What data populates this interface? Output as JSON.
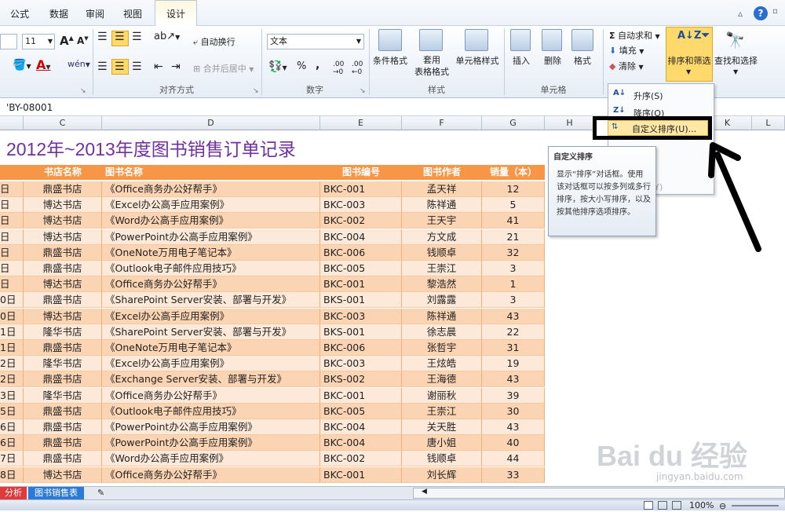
{
  "ribbon_tabs": [
    "公式",
    "数据",
    "审阅",
    "视图",
    "设计"
  ],
  "font": {
    "size": "11",
    "grow_glyph": "A",
    "shrink_glyph": "A"
  },
  "alignment": {
    "group_label": "对齐方式",
    "wrap_label": "自动换行",
    "merge_label": "合并后居中"
  },
  "number": {
    "group_label": "数字",
    "format_value": "文本",
    "percent": "%",
    "comma": ","
  },
  "styles": {
    "group_label": "样式",
    "conditional": "条件格式",
    "table_format": "套用\n表格格式",
    "cell_styles": "单元格样式"
  },
  "cells": {
    "group_label": "单元格",
    "insert": "插入",
    "delete": "删除",
    "format": "格式"
  },
  "editing": {
    "autosum": "自动求和",
    "fill": "填充",
    "clear": "清除",
    "sort_filter": "排序和筛选",
    "find_select": "查找和选择",
    "sigma": "Σ"
  },
  "formula_bar": "'BY-08001",
  "columns": [
    "C",
    "D",
    "E",
    "F",
    "G",
    "H",
    "I",
    "K",
    "L"
  ],
  "sheet_title": "2012年~2013年度图书销售订单记录",
  "table_headers": [
    "书店名称",
    "图书名称",
    "图书编号",
    "图书作者",
    "销量（本）"
  ],
  "rows": [
    {
      "d": "日",
      "store": "鼎盛书店",
      "book": "《Office商务办公好帮手》",
      "id": "BKC-001",
      "author": "孟天祥",
      "qty": "12"
    },
    {
      "d": "日",
      "store": "博达书店",
      "book": "《Excel办公高手应用案例》",
      "id": "BKC-003",
      "author": "陈祥通",
      "qty": "5"
    },
    {
      "d": "日",
      "store": "博达书店",
      "book": "《Word办公高手应用案例》",
      "id": "BKC-002",
      "author": "王天宇",
      "qty": "41"
    },
    {
      "d": "日",
      "store": "博达书店",
      "book": "《PowerPoint办公高手应用案例》",
      "id": "BKC-004",
      "author": "方文成",
      "qty": "21"
    },
    {
      "d": "日",
      "store": "鼎盛书店",
      "book": "《OneNote万用电子笔记本》",
      "id": "BKC-006",
      "author": "钱顺卓",
      "qty": "32"
    },
    {
      "d": "日",
      "store": "鼎盛书店",
      "book": "《Outlook电子邮件应用技巧》",
      "id": "BKC-005",
      "author": "王崇江",
      "qty": "3"
    },
    {
      "d": "日",
      "store": "博达书店",
      "book": "《Office商务办公好帮手》",
      "id": "BKC-001",
      "author": "黎浩然",
      "qty": "1"
    },
    {
      "d": "0日",
      "store": "鼎盛书店",
      "book": "《SharePoint Server安装、部署与开发》",
      "id": "BKS-001",
      "author": "刘露露",
      "qty": "3"
    },
    {
      "d": "0日",
      "store": "博达书店",
      "book": "《Excel办公高手应用案例》",
      "id": "BKC-003",
      "author": "陈祥通",
      "qty": "43"
    },
    {
      "d": "1日",
      "store": "隆华书店",
      "book": "《SharePoint Server安装、部署与开发》",
      "id": "BKS-001",
      "author": "徐志晨",
      "qty": "22"
    },
    {
      "d": "1日",
      "store": "鼎盛书店",
      "book": "《OneNote万用电子笔记本》",
      "id": "BKC-006",
      "author": "张哲宇",
      "qty": "31"
    },
    {
      "d": "2日",
      "store": "隆华书店",
      "book": "《Excel办公高手应用案例》",
      "id": "BKC-003",
      "author": "王炫皓",
      "qty": "19"
    },
    {
      "d": "2日",
      "store": "鼎盛书店",
      "book": "《Exchange Server安装、部署与开发》",
      "id": "BKS-002",
      "author": "王海德",
      "qty": "43"
    },
    {
      "d": "3日",
      "store": "隆华书店",
      "book": "《Office商务办公好帮手》",
      "id": "BKC-001",
      "author": "谢丽秋",
      "qty": "39"
    },
    {
      "d": "5日",
      "store": "鼎盛书店",
      "book": "《Outlook电子邮件应用技巧》",
      "id": "BKC-005",
      "author": "王崇江",
      "qty": "30"
    },
    {
      "d": "6日",
      "store": "鼎盛书店",
      "book": "《PowerPoint办公高手应用案例》",
      "id": "BKC-004",
      "author": "关天胜",
      "qty": "43"
    },
    {
      "d": "6日",
      "store": "鼎盛书店",
      "book": "《PowerPoint办公高手应用案例》",
      "id": "BKC-004",
      "author": "唐小姐",
      "qty": "40"
    },
    {
      "d": "7日",
      "store": "鼎盛书店",
      "book": "《Word办公高手应用案例》",
      "id": "BKC-002",
      "author": "钱顺卓",
      "qty": "44"
    },
    {
      "d": "8日",
      "store": "博达书店",
      "book": "《Office商务办公好帮手》",
      "id": "BKC-001",
      "author": "刘长辉",
      "qty": "33"
    }
  ],
  "sort_menu": {
    "asc": "升序(S)",
    "desc": "降序(O)",
    "custom": "自定义排序(U)...",
    "reapply": "应用(Y)"
  },
  "tooltip": {
    "title": "自定义排序",
    "body": "显示“排序”对话框。使用该对话框可以按多列或多行排序，按大小写排序，以及按其他排序选项排序。"
  },
  "sheet_tabs": [
    "分析",
    "图书销售表"
  ],
  "status": {
    "zoom": "100%"
  },
  "watermark": {
    "brand": "Bai du 经验",
    "url": "jingyan.baidu.com"
  }
}
